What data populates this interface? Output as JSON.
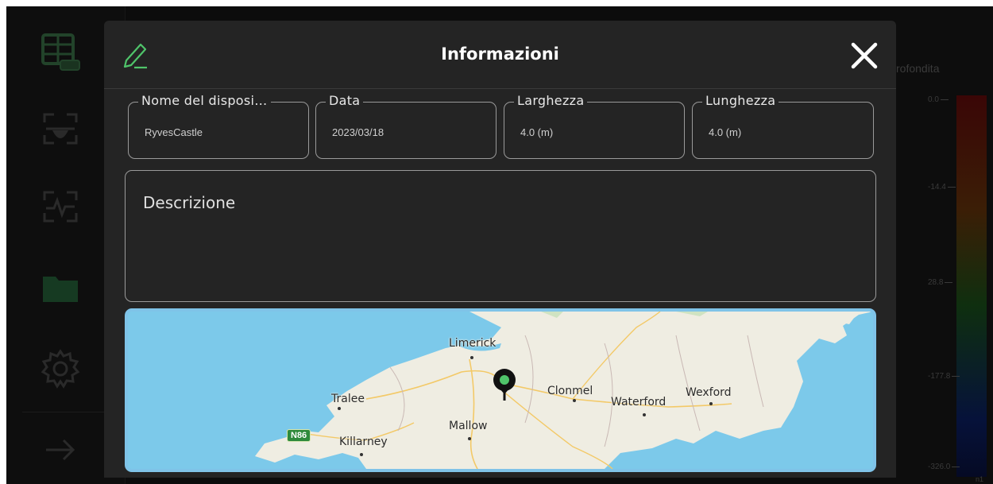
{
  "background": {
    "right_panel_label": "rofondita",
    "depth_scale": [
      "0.0",
      "-14.4",
      "28.8",
      "-177.8",
      "-326.0"
    ],
    "depth_unit": "n1"
  },
  "modal": {
    "title": "Informazioni",
    "fields": [
      {
        "label": "Nome del disposi…",
        "value": "RyvesCastle"
      },
      {
        "label": "Data",
        "value": "2023/03/18"
      },
      {
        "label": "Larghezza",
        "value": "4.0 (m)"
      },
      {
        "label": "Lunghezza",
        "value": "4.0 (m)"
      }
    ],
    "description_label": "Descrizione",
    "map": {
      "places": [
        "Limerick",
        "Tralee",
        "Mallow",
        "Clonmel",
        "Waterford",
        "Wexford",
        "Killarney"
      ],
      "road_badge": "N86"
    }
  },
  "colors": {
    "accent_green": "#4fc46a",
    "modal_bg": "#242424",
    "sea": "#7cc9ea",
    "land": "#efede2"
  }
}
